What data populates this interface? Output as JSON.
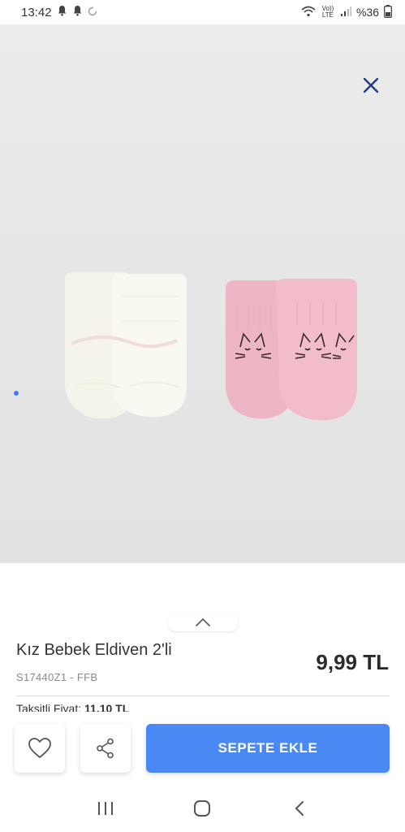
{
  "status_bar": {
    "time": "13:42",
    "network": "Vo)) LTE",
    "battery": "%36"
  },
  "product": {
    "title": "Kız Bebek Eldiven 2'li",
    "sku": "S17440Z1 - FFB",
    "price": "9,99 TL",
    "installment_label": "Taksitli Fiyat:",
    "installment_price": "11,10 TL"
  },
  "actions": {
    "add_to_cart_label": "SEPETE EKLE"
  },
  "icons": {
    "close": "close-icon",
    "favorite": "heart-icon",
    "share": "share-icon",
    "handle": "chevron-up-icon",
    "nav_recent": "recent-apps-icon",
    "nav_home": "home-icon",
    "nav_back": "back-icon"
  },
  "colors": {
    "accent": "#4a88f3",
    "close_icon": "#1f3a8a",
    "dot": "#3d7bf5"
  }
}
